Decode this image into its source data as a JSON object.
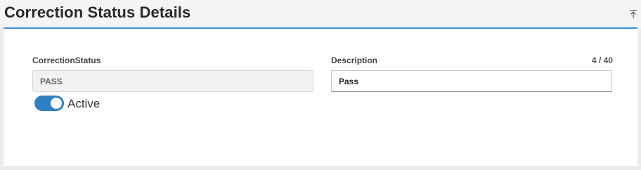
{
  "header": {
    "title": "Correction Status Details",
    "collapse_icon": "collapse-up-icon"
  },
  "form": {
    "correction_status": {
      "label": "CorrectionStatus",
      "value": "PASS"
    },
    "description": {
      "label": "Description",
      "value": "Pass",
      "counter": "4 / 40"
    },
    "active": {
      "label": "Active",
      "checked": true
    }
  },
  "colors": {
    "accent": "#3c8fd6",
    "toggle_on": "#2f7fc2"
  }
}
